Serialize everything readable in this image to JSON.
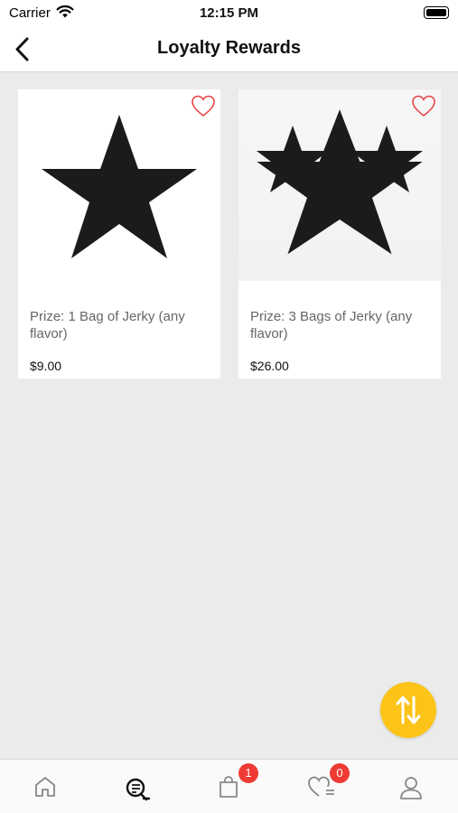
{
  "status_bar": {
    "carrier": "Carrier",
    "time": "12:15 PM"
  },
  "nav": {
    "title": "Loyalty Rewards",
    "back_icon": "chevron-left-icon"
  },
  "products": [
    {
      "title": "Prize: 1 Bag of Jerky (any flavor)",
      "price": "$9.00",
      "image": "single-star",
      "favorited": false
    },
    {
      "title": "Prize: 3 Bags of Jerky (any flavor)",
      "price": "$26.00",
      "image": "three-stars",
      "favorited": false
    }
  ],
  "fab": {
    "icon": "sort-arrows-icon",
    "color": "#fcc419"
  },
  "tab_bar": {
    "items": [
      {
        "name": "home",
        "icon": "home-icon"
      },
      {
        "name": "search",
        "icon": "search-list-icon"
      },
      {
        "name": "cart",
        "icon": "shopping-bag-icon",
        "badge": "1"
      },
      {
        "name": "wishlist",
        "icon": "heart-list-icon",
        "badge": "0"
      },
      {
        "name": "account",
        "icon": "user-icon"
      }
    ]
  },
  "colors": {
    "accent": "#fcc419",
    "badge": "#ee3b33",
    "heart": "#e84545",
    "background": "#ebebeb"
  }
}
